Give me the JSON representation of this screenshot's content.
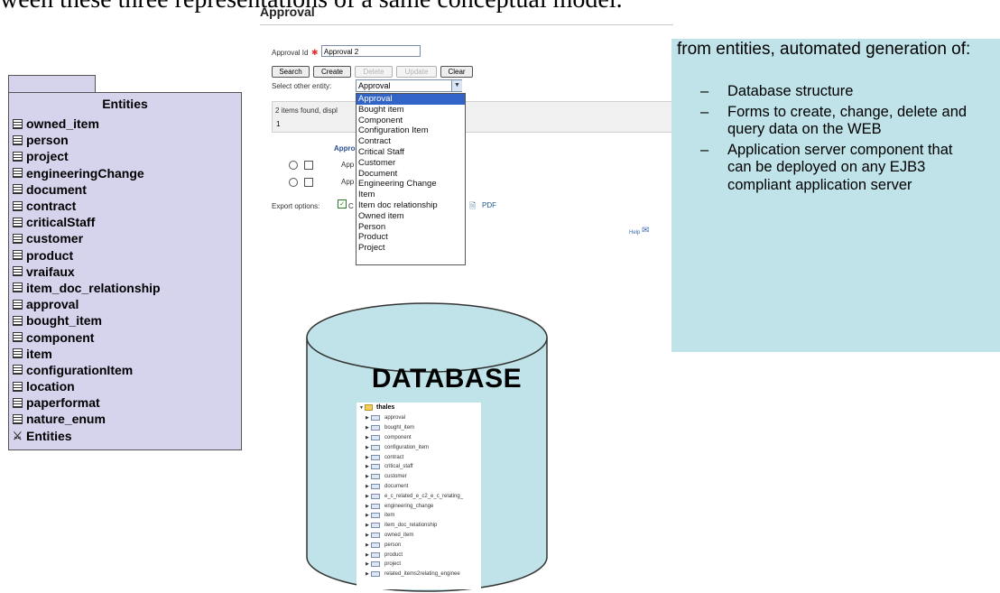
{
  "caption": "ween these three representations of a same conceptual model.",
  "entities": {
    "title": "Entities",
    "items": [
      "owned_item",
      "person",
      "project",
      "engineeringChange",
      "document",
      "contract",
      "criticalStaff",
      "customer",
      "product",
      "vraifaux",
      "item_doc_relationship",
      "approval",
      "bought_item",
      "component",
      "item",
      "configurationItem",
      "location",
      "paperformat",
      "nature_enum"
    ],
    "package_label": "Entities"
  },
  "approval_form": {
    "title": "Approval",
    "approval_id_label": "Approval Id",
    "approval_id_value": "Approval 2",
    "buttons": {
      "search": "Search",
      "create": "Create",
      "delete": "Delete",
      "update": "Update",
      "clear": "Clear"
    },
    "select_other_label": "Select other entity:",
    "selected_entity": "Approval",
    "results_text": "2 items found, displ",
    "results_page": "1",
    "column_header": "Appro",
    "rows": [
      "App",
      "App"
    ],
    "export_label": "Export options:",
    "export_option_1": "C",
    "pdf_label": "PDF",
    "help_label": "Help",
    "dropdown_options": [
      "Approval",
      "Bought item",
      "Component",
      "Configuration Item",
      "Contract",
      "Critical Staff",
      "Customer",
      "Document",
      "Engineering Change",
      "Item",
      "Item doc relationship",
      "Owned item",
      "Person",
      "Product",
      "Project"
    ]
  },
  "info": {
    "intro": "from entities, automated generation of:",
    "bullets": [
      "Database structure",
      "Forms to create, change, delete and query data on the WEB",
      "Application server component that can be deployed on any EJB3 compliant application server"
    ],
    "bullet_marker": "–"
  },
  "database": {
    "label": "DATABASE",
    "schema": "thales",
    "tables": [
      "approval",
      "bought_item",
      "component",
      "configuration_item",
      "contract",
      "critical_staff",
      "customer",
      "document",
      "e_c_related_e_c2_e_c_relating_",
      "engineering_change",
      "item",
      "item_doc_relationship",
      "owned_item",
      "person",
      "product",
      "project",
      "related_items2relating_enginee"
    ]
  },
  "colors": {
    "entities_panel": "#d6d3ec",
    "info_box": "#bfe3e8",
    "cylinder_fill": "#bfe3e8",
    "dropdown_selected": "#3264c8"
  }
}
